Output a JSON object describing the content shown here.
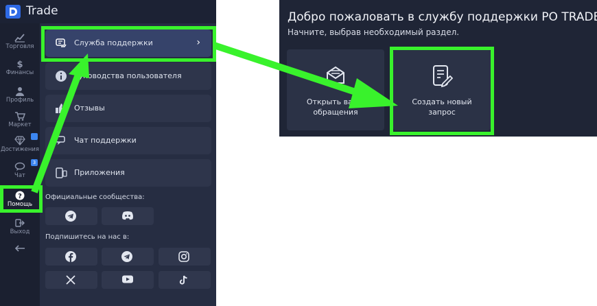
{
  "app": {
    "brand": "Trade",
    "rail": [
      {
        "label": "Торговля",
        "icon": "chart-icon"
      },
      {
        "label": "Финансы",
        "icon": "dollar-icon"
      },
      {
        "label": "Профиль",
        "icon": "user-icon"
      },
      {
        "label": "Маркет",
        "icon": "cart-icon"
      },
      {
        "label": "Достижения",
        "icon": "diamond-icon",
        "badge": ""
      },
      {
        "label": "Чат",
        "icon": "chat-icon",
        "badge": "3"
      },
      {
        "label": "Помощь",
        "icon": "help-icon",
        "active": true
      },
      {
        "label": "Выход",
        "icon": "logout-icon"
      }
    ],
    "help_menu": [
      {
        "label": "Служба поддержки",
        "active": true
      },
      {
        "label": "Руководства пользователя"
      },
      {
        "label": "Отзывы"
      },
      {
        "label": "Чат поддержки"
      },
      {
        "label": "Приложения"
      }
    ],
    "official_communities_label": "Официальные сообщества:",
    "subscribe_label": "Подпишитесь на нас в:"
  },
  "support": {
    "title": "Добро пожаловать в службу поддержки PO TRADE.",
    "subtitle": "Начните, выбрав необходимый раздел.",
    "open_tile": {
      "line1": "Открыть ваши",
      "line2": "обращения"
    },
    "create_tile": {
      "line1": "Создать новый",
      "line2": "запрос"
    }
  },
  "colors": {
    "highlight": "#39f22c",
    "accent": "#3c86f0"
  }
}
